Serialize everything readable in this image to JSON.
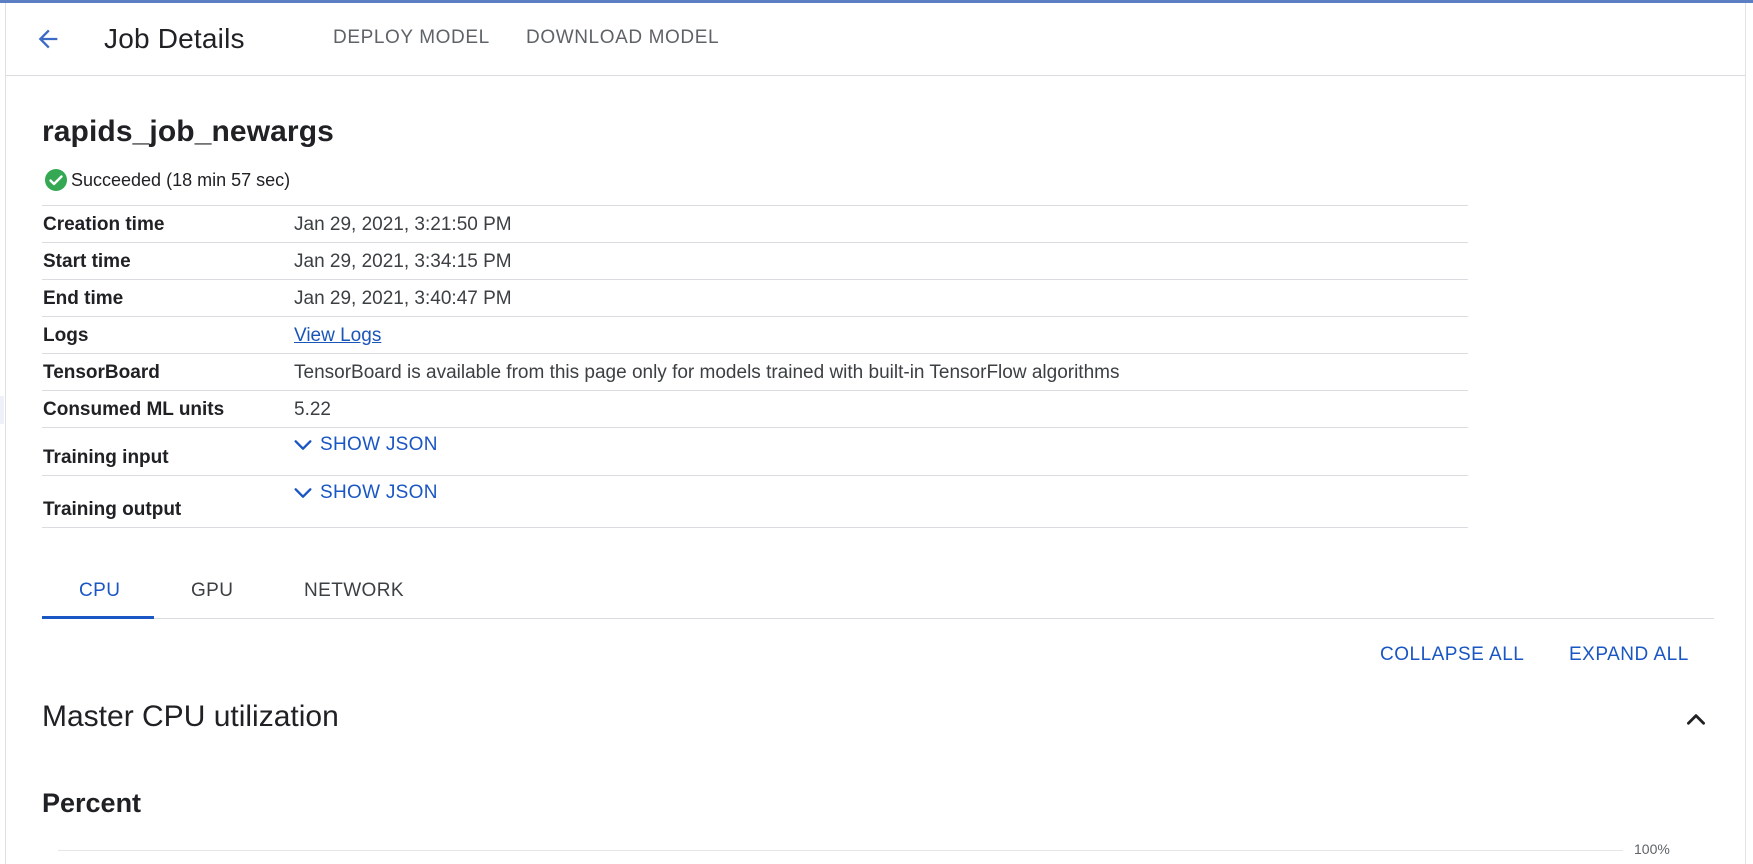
{
  "header": {
    "title": "Job Details",
    "deploy_label": "DEPLOY MODEL",
    "download_label": "DOWNLOAD MODEL",
    "back_icon": "arrow-back-icon"
  },
  "job": {
    "name": "rapids_job_newargs",
    "status": "Succeeded (18 min 57 sec)",
    "status_icon": "check-circle-icon",
    "status_color": "#34a853"
  },
  "details": {
    "creation_time": {
      "label": "Creation time",
      "value": "Jan 29, 2021, 3:21:50 PM"
    },
    "start_time": {
      "label": "Start time",
      "value": "Jan 29, 2021, 3:34:15 PM"
    },
    "end_time": {
      "label": "End time",
      "value": "Jan 29, 2021, 3:40:47 PM"
    },
    "logs": {
      "label": "Logs",
      "value": "View Logs"
    },
    "tensorboard": {
      "label": "TensorBoard",
      "value": "TensorBoard is available from this page only for models trained with built-in TensorFlow algorithms"
    },
    "consumed_ml_units": {
      "label": "Consumed ML units",
      "value": "5.22"
    },
    "training_input": {
      "label": "Training input",
      "toggle": "SHOW JSON"
    },
    "training_output": {
      "label": "Training output",
      "toggle": "SHOW JSON"
    }
  },
  "tabs": [
    {
      "label": "CPU",
      "active": true
    },
    {
      "label": "GPU",
      "active": false
    },
    {
      "label": "NETWORK",
      "active": false
    }
  ],
  "actions": {
    "collapse_all": "COLLAPSE ALL",
    "expand_all": "EXPAND ALL"
  },
  "section": {
    "title": "Master CPU utilization",
    "subtitle": "Percent",
    "axis_max_label": "100%"
  },
  "colors": {
    "accent": "#1a56c4",
    "top_bar": "#5c7fc4"
  }
}
